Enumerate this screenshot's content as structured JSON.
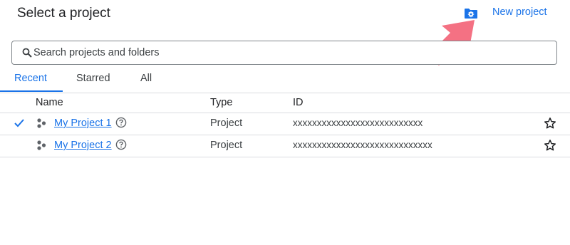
{
  "dialog": {
    "title": "Select a project",
    "new_project_label": "New project"
  },
  "search": {
    "placeholder": "Search projects and folders",
    "value": ""
  },
  "tabs": [
    {
      "label": "Recent",
      "active": true
    },
    {
      "label": "Starred",
      "active": false
    },
    {
      "label": "All",
      "active": false
    }
  ],
  "table": {
    "headers": {
      "name": "Name",
      "type": "Type",
      "id": "ID"
    },
    "rows": [
      {
        "selected": true,
        "name": "My Project 1",
        "type": "Project",
        "id": "xxxxxxxxxxxxxxxxxxxxxxxxxxx"
      },
      {
        "selected": false,
        "name": "My Project 2",
        "type": "Project",
        "id": "xxxxxxxxxxxxxxxxxxxxxxxxxxxxx"
      }
    ]
  },
  "colors": {
    "accent": "#1a73e8",
    "arrow": "#f47183",
    "border": "#dadce0"
  },
  "icons": [
    "folder-settings-icon",
    "search-icon",
    "check-icon",
    "project-icon",
    "help-icon",
    "star-icon",
    "arrow-annotation"
  ]
}
